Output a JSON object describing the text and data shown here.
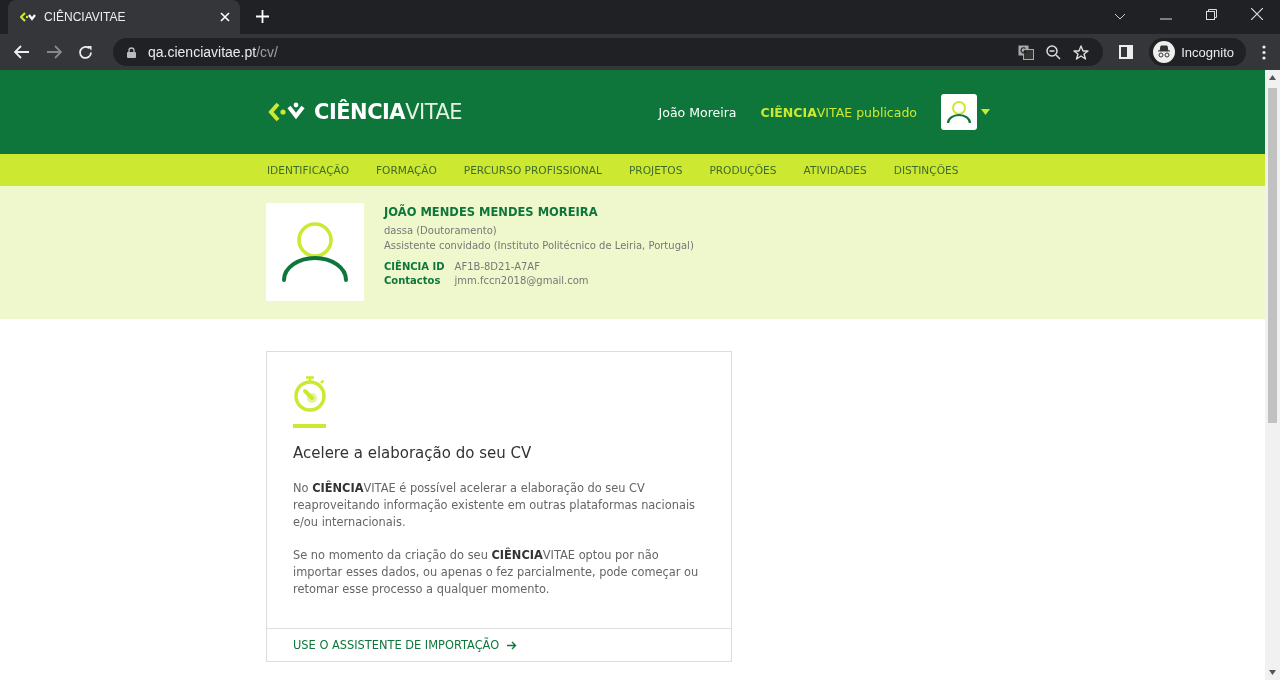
{
  "browser": {
    "tab": {
      "title": "CIÊNCIAVITAE"
    },
    "address": {
      "host": "qa.cienciavitae.pt",
      "path": "/cv/"
    },
    "profile_label": "Incognito"
  },
  "header": {
    "logo": "**CIÊNCIA**VITAE",
    "user_name": "João Moreira",
    "status": "**CIÊNCIA**VITAE publicado"
  },
  "nav": {
    "items": [
      {
        "label": "IDENTIFICAÇÃO",
        "selected": false
      },
      {
        "label": "FORMAÇÃO",
        "selected": false
      },
      {
        "label": "PERCURSO PROFISSIONAL",
        "selected": false
      },
      {
        "label": "PROJETOS",
        "selected": false
      },
      {
        "label": "PRODUÇÕES",
        "selected": false
      },
      {
        "label": "ATIVIDADES",
        "selected": false
      },
      {
        "label": "DISTINÇÕES",
        "selected": false
      }
    ]
  },
  "profile": {
    "name": "JOÃO MENDES MENDES MOREIRA",
    "degree": "dassa (Doutoramento)",
    "position": "Assistente convidado (Instituto Politécnico de Leiria, Portugal)",
    "fields": [
      {
        "label": "CIÊNCIA ID",
        "value": "AF1B-8D21-A7AF"
      },
      {
        "label": "Contactos",
        "value": "jmm.fccn2018@gmail.com"
      }
    ]
  },
  "card": {
    "title": "Acelere a elaboração do seu CV",
    "paragraphs": [
      "No **CIÊNCIA**VITAE é possível acelerar a elaboração do seu CV reaproveitando informação existente em outras plataformas nacionais e/ou internacionais.",
      "Se no momento da criação do seu **CIÊNCIA**VITAE optou por não importar esses dados, ou apenas o fez parcialmente, pode começar ou retomar esse processo a qualquer momento."
    ],
    "link": "USE O ASSISTENTE DE IMPORTAÇÃO"
  }
}
